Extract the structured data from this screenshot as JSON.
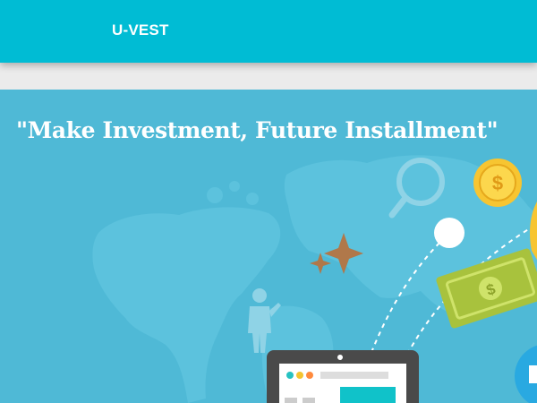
{
  "navbar": {
    "brand": "U-VEST",
    "background_color": "#00bcd4"
  },
  "hero": {
    "tagline": "\"Make Investment, Future Installment\"",
    "background_color": "#4fb9d6",
    "illustration": {
      "coin_symbol": "$",
      "bill_symbol": "$",
      "icons": [
        "world-map",
        "magnifier-icon",
        "coin-icon",
        "dollar-bill-icon",
        "sparkle-icon",
        "businessman-icon",
        "laptop-icon"
      ]
    }
  }
}
